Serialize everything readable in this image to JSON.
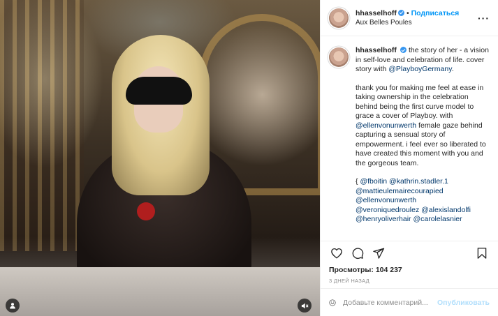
{
  "post": {
    "author": {
      "username": "hhasselhoff",
      "verified": true,
      "follow_label": "Подписаться",
      "location": "Aux Belles Poules"
    },
    "caption": {
      "username": "hhasselhoff",
      "line1_text": "the story of her - a vision in self-love and celebration of life. cover story with ",
      "mention1": "@PlayboyGermany",
      "line1_end": ".",
      "para2_text": "thank you for making me feel at ease in taking ownership in the celebration behind being the first curve model to grace a cover of Playboy. with ",
      "mention2": "@ellenvonunwerth",
      "para2_end": " female gaze behind capturing a sensual story of empowerment. i feel ever so liberated to have created this moment with you and the gorgeous team.",
      "para3_open": "{ ",
      "mentions3": [
        "@fboitin",
        "@kathrin.stadler.1",
        "@mattieulemairecourapied",
        "@ellenvonunwerth",
        "@veroniquedroulez",
        "@alexislandolfi",
        "@henryoliverhair",
        "@carolelasnier"
      ]
    },
    "stats": {
      "views_label": "Просмотры:",
      "views_value": "104 237",
      "timestamp": "3 ДНЕЙ НАЗАД"
    },
    "comment": {
      "placeholder": "Добавьте комментарий...",
      "publish_label": "Опубликовать"
    },
    "icons": {
      "more": "more-horizontal-icon",
      "like": "heart-icon",
      "comment": "comment-icon",
      "share": "paper-plane-icon",
      "save": "bookmark-icon",
      "emoji": "smiley-icon",
      "audio": "mute-speaker-icon",
      "tags": "user-tag-icon"
    },
    "colors": {
      "link": "#0095f6",
      "mention": "#00376b",
      "verified": "#3897f0",
      "muted": "#8e8e8e"
    }
  }
}
